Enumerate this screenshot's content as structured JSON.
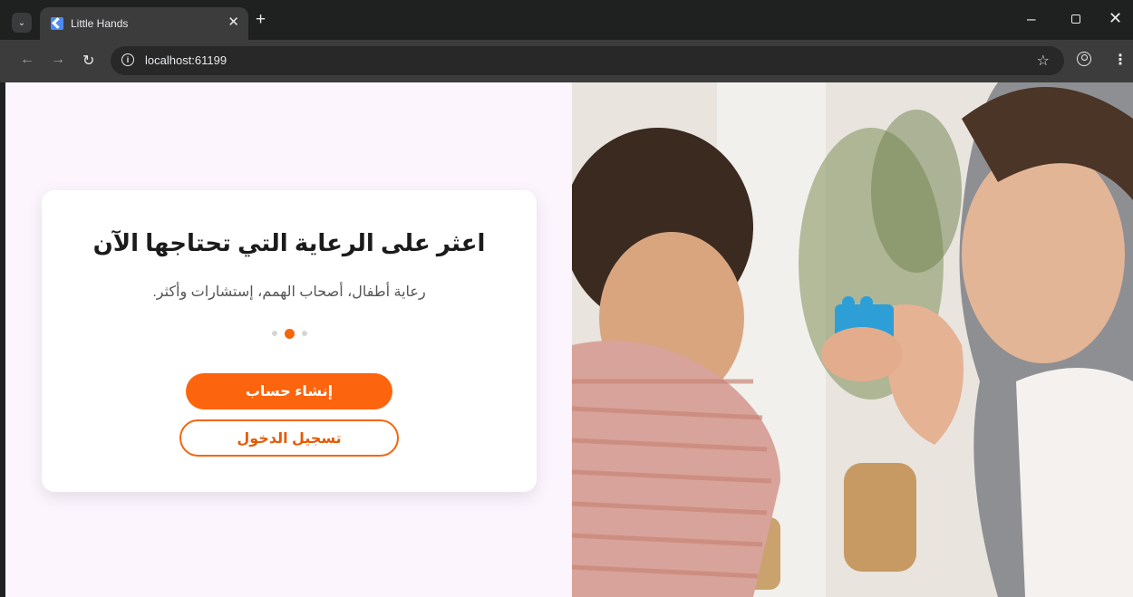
{
  "browser": {
    "tab_title": "Little Hands",
    "url": "localhost:61199"
  },
  "colors": {
    "accent": "#fc640d",
    "page_bg": "#fdf5fe"
  },
  "onboarding": {
    "title": "اعثر على الرعاية التي تحتاجها الآن",
    "subtitle": "رعاية أطفال، أصحاب الهمم، إستشارات وأكثر.",
    "page_indicator": {
      "count": 3,
      "active_index": 1
    },
    "primary_button": "إنشاء حساب",
    "secondary_button": "تسجيل الدخول"
  },
  "hero_image": {
    "description_icon": "photo-mother-child-playing"
  }
}
